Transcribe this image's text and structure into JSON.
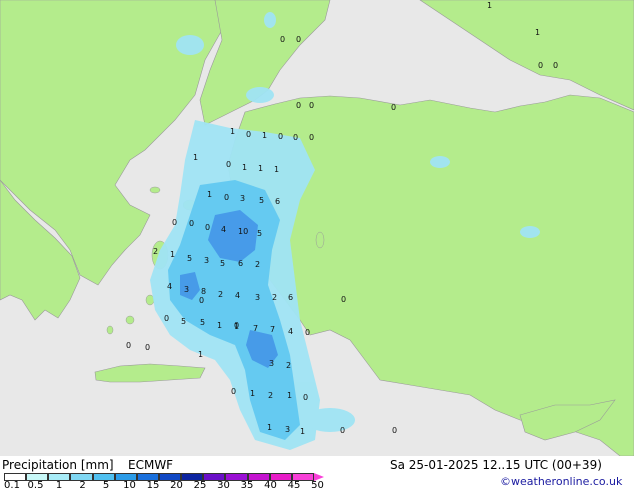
{
  "title": "Precipitation [mm]",
  "model": "ECMWF",
  "valid_time": "Sa 25-01-2025 12..15 UTC (00+39)",
  "credit": "©weatheronline.co.uk",
  "colors": {
    "sea": "#e8e8e8",
    "land": "#b4ec8c",
    "light_rain": "#a0e4f4",
    "moderate_rain": "#62c8f0",
    "heavy_rain": "#4496e8"
  },
  "legend": {
    "ticks": [
      "0.1",
      "0.5",
      "1",
      "2",
      "5",
      "10",
      "15",
      "20",
      "25",
      "30",
      "35",
      "40",
      "45",
      "50"
    ],
    "colors": [
      "#ffffff",
      "#c8f8f8",
      "#a8ecf8",
      "#80d8f4",
      "#50c0f0",
      "#2c9ce8",
      "#1a70dc",
      "#1048c4",
      "#0c24a0",
      "#6a10c8",
      "#9a10d4",
      "#c414d0",
      "#e81cc8",
      "#f840d8"
    ]
  },
  "map_values": [
    "1",
    "1",
    "0",
    "0",
    "0",
    "0",
    "0",
    "0",
    "0",
    "1",
    "0",
    "1",
    "0",
    "0",
    "0",
    "1",
    "0",
    "1",
    "1",
    "1",
    "1",
    "0",
    "3",
    "5",
    "6",
    "0",
    "0",
    "0",
    "4",
    "10",
    "5",
    "2",
    "1",
    "5",
    "3",
    "5",
    "6",
    "2",
    "4",
    "3",
    "8",
    "2",
    "4",
    "3",
    "2",
    "6",
    "0",
    "5",
    "5",
    "1",
    "1",
    "7",
    "7",
    "4",
    "0",
    "1",
    "0",
    "3",
    "2",
    "0",
    "1",
    "2",
    "1",
    "0",
    "1",
    "3",
    "1",
    "0",
    "0",
    "0",
    "0",
    "0",
    "0"
  ]
}
